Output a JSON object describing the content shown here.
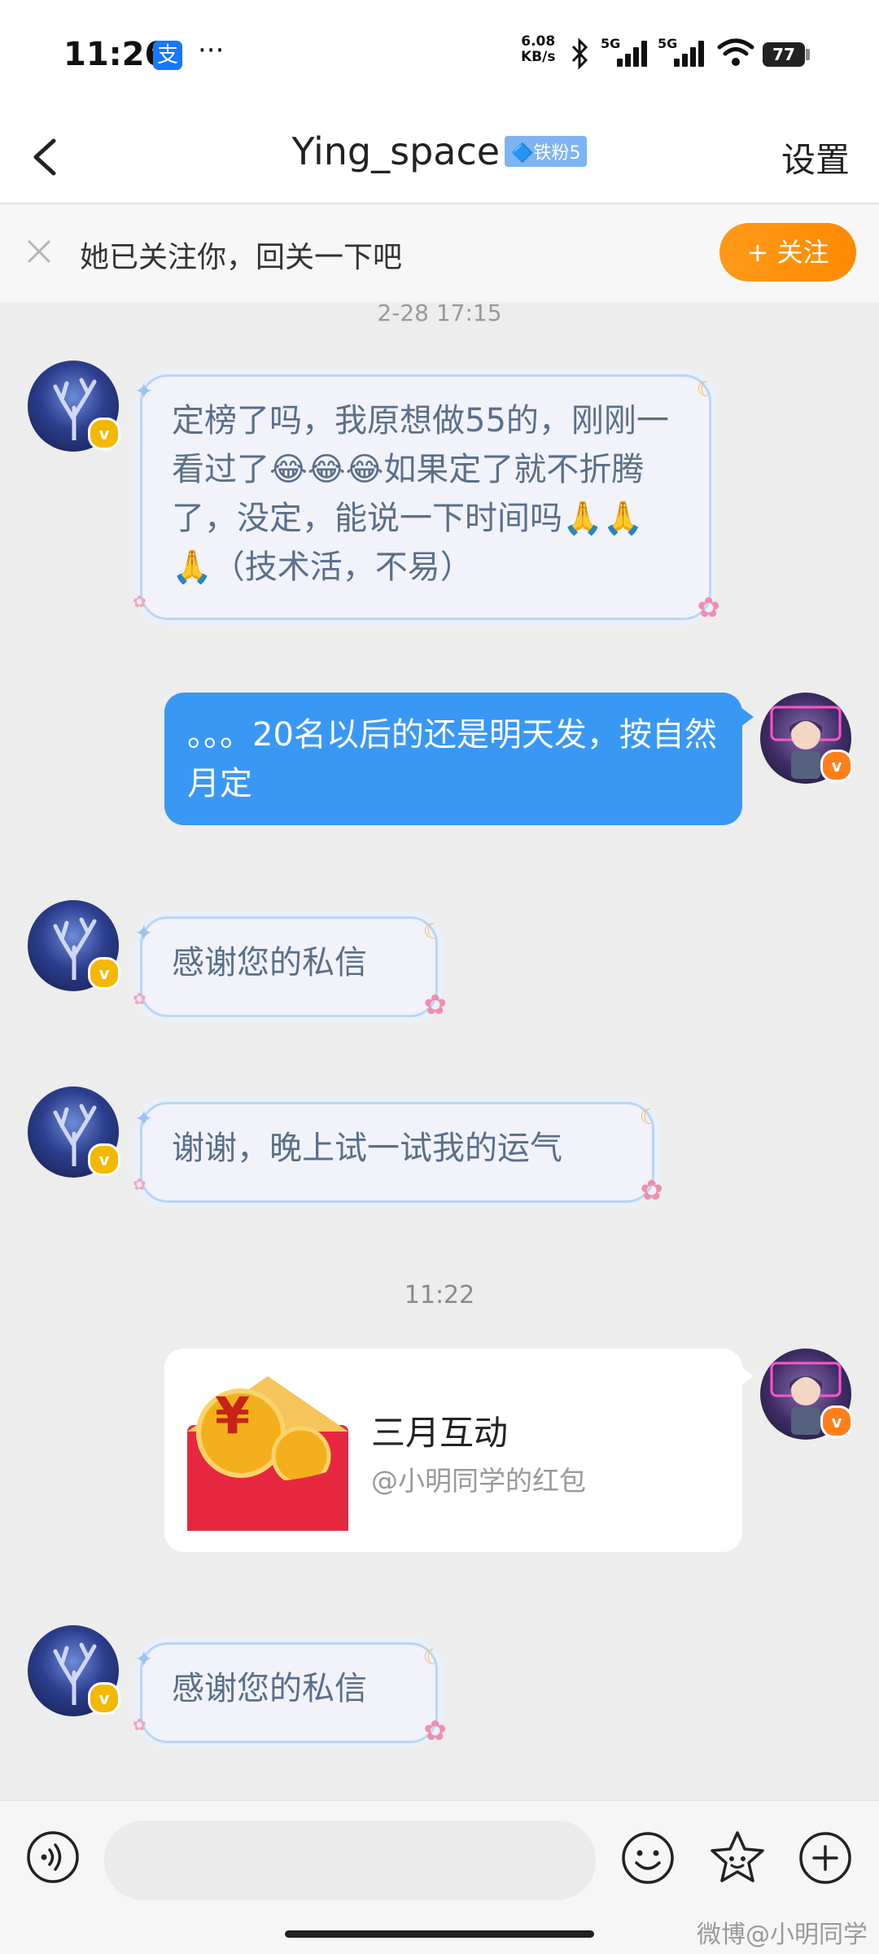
{
  "status_bar": {
    "time": "11:26",
    "alipay_icon_char": "支",
    "more": "···",
    "net_speed_value": "6.08",
    "net_speed_unit": "KB/s",
    "sim1_label": "5G",
    "sim2_label": "5G",
    "battery": "77"
  },
  "header": {
    "title": "Ying_space",
    "fan_badge": "🔷铁粉5",
    "settings_label": "设置"
  },
  "follow_notice": {
    "text": "她已关注你，回关一下吧",
    "follow_button": "+ 关注"
  },
  "partial_timestamp": "2-28 17:15",
  "messages": [
    {
      "side": "left",
      "text": "定榜了吗，我原想做55的，刚刚一看过了😂😂😂如果定了就不折腾了，没定，能说一下时间吗🙏🙏🙏（技术活，不易）"
    },
    {
      "side": "right",
      "text": "。。。20名以后的还是明天发，按自然月定"
    },
    {
      "side": "left",
      "text": "感谢您的私信"
    },
    {
      "side": "left",
      "text": "谢谢，晚上试一试我的运气"
    },
    {
      "side": "right",
      "type": "red_packet",
      "title": "三月互动",
      "subtitle": "@小明同学的红包"
    },
    {
      "side": "left",
      "text": "感谢您的私信"
    }
  ],
  "timestamp_2": "11:22",
  "red_packet_symbol": "¥",
  "verified_mark": "v",
  "watermark": "微博@小明同学",
  "colors": {
    "accent_blue": "#3a98f5",
    "follow_orange": "#ff8a00",
    "bubble_border": "#bcd5f2"
  },
  "icons": [
    "back-icon",
    "close-icon",
    "voice-icon",
    "emoji-icon",
    "sticker-icon",
    "plus-icon"
  ]
}
